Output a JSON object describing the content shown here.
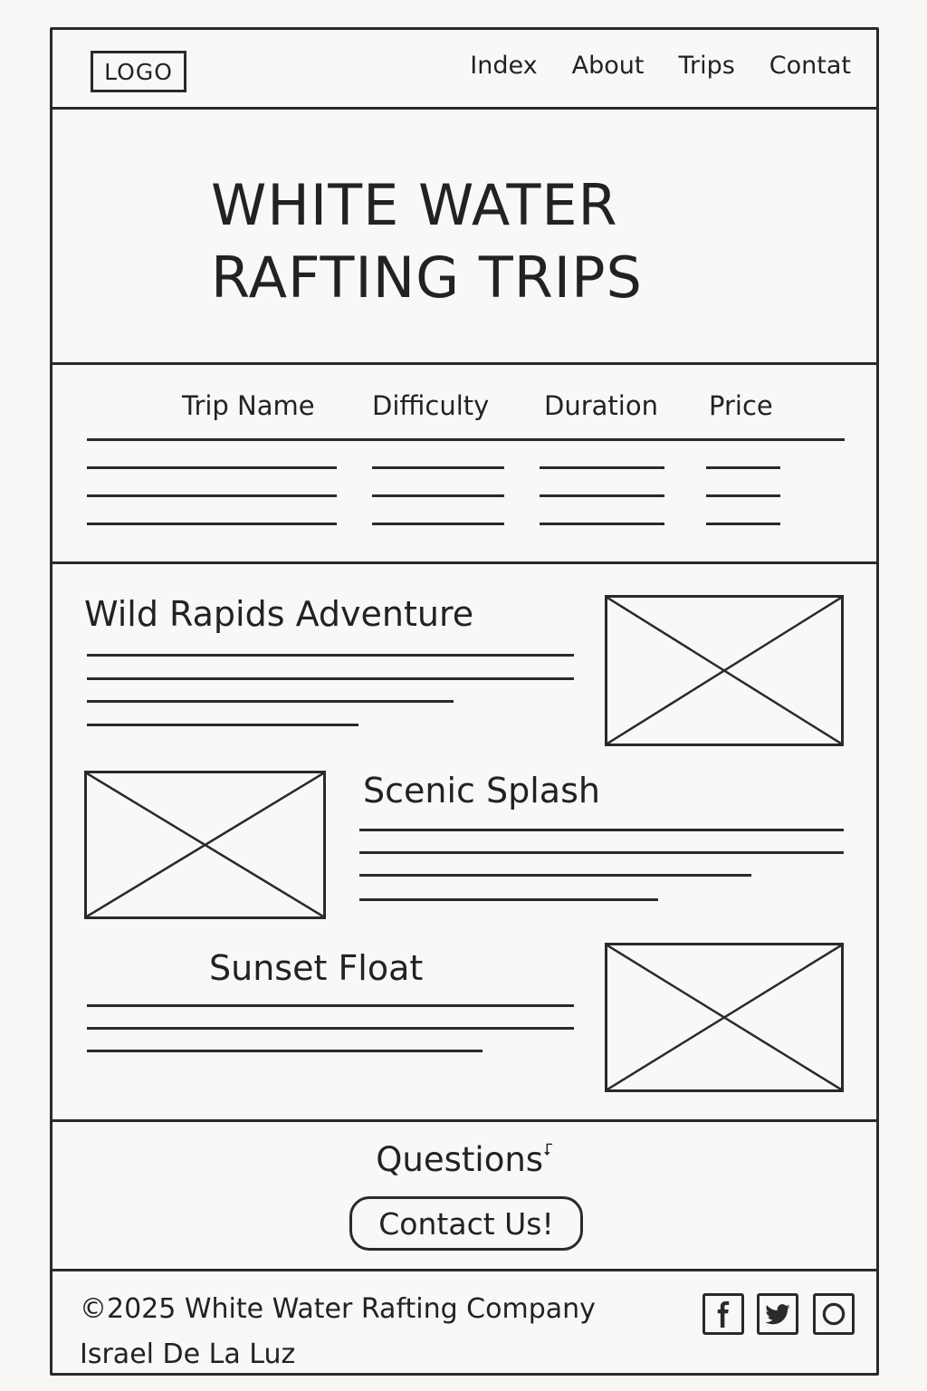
{
  "header": {
    "logo": "LOGO",
    "nav": [
      "Index",
      "About",
      "Trips",
      "Contat"
    ]
  },
  "hero": {
    "title_line1": "WHITE WATER",
    "title_line2": "RAFTING TRIPS"
  },
  "table": {
    "headers": [
      "Trip Name",
      "Difficulty",
      "Duration",
      "Price"
    ]
  },
  "trips": [
    {
      "title": "Wild Rapids Adventure",
      "image": "image-placeholder"
    },
    {
      "title": "Scenic Splash",
      "image": "image-placeholder"
    },
    {
      "title": "Sunset Float",
      "image": "image-placeholder"
    }
  ],
  "cta": {
    "question": "Questions",
    "button": "Contact Us!"
  },
  "footer": {
    "copyright": "©2025 White Water Rafting Company",
    "author": "Israel De La Luz",
    "social_icons": [
      "facebook-icon",
      "twitter-icon",
      "instagram-icon"
    ]
  }
}
